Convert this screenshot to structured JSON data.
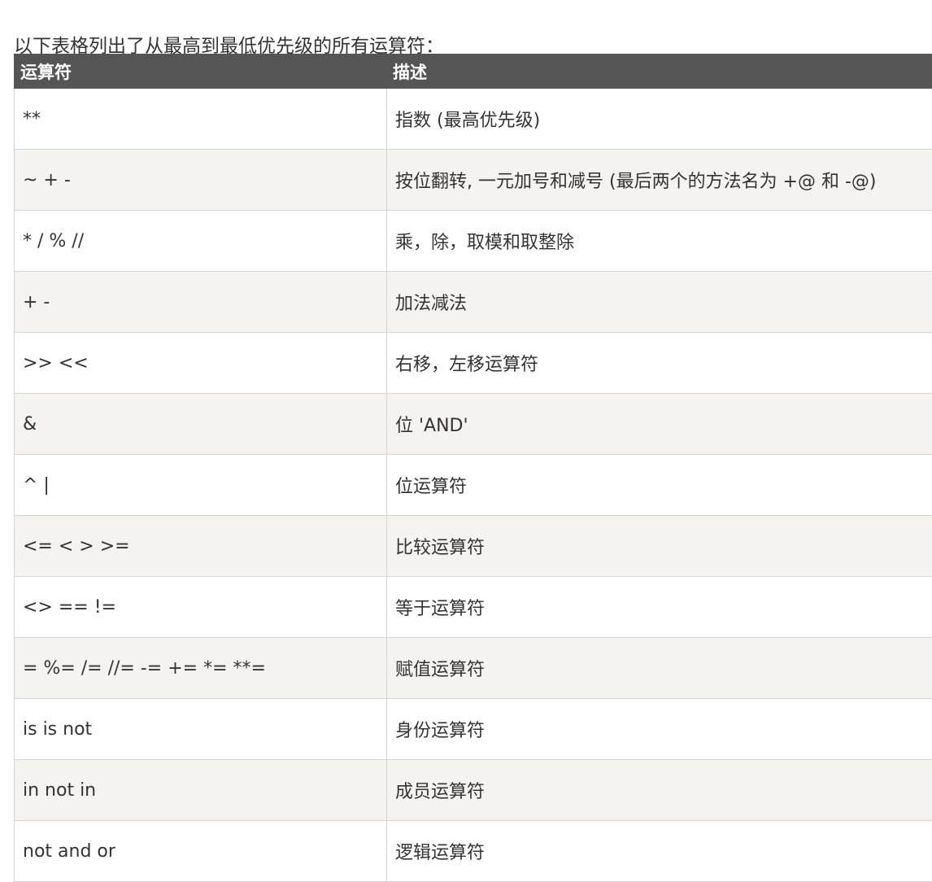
{
  "intro": "以下表格列出了从最高到最低优先级的所有运算符：",
  "table": {
    "headers": [
      "运算符",
      "描述"
    ],
    "rows": [
      [
        "**",
        "指数 (最高优先级)"
      ],
      [
        "~ + -",
        "按位翻转, 一元加号和减号 (最后两个的方法名为 +@ 和 -@)"
      ],
      [
        "* / % //",
        "乘，除，取模和取整除"
      ],
      [
        "+ -",
        "加法减法"
      ],
      [
        ">> <<",
        "右移，左移运算符"
      ],
      [
        "&",
        "位 'AND'"
      ],
      [
        "^ |",
        "位运算符"
      ],
      [
        "<= < > >=",
        "比较运算符"
      ],
      [
        "<> == !=",
        "等于运算符"
      ],
      [
        "= %= /= //= -= += *= **=",
        "赋值运算符"
      ],
      [
        "is is not",
        "身份运算符"
      ],
      [
        "in not in",
        "成员运算符"
      ],
      [
        "not and or",
        "逻辑运算符"
      ]
    ]
  },
  "colors": {
    "header_bg": "#555555",
    "header_text": "#ffffff",
    "row_alt_bg": "#f4f3f0",
    "border": "#d4d4d4",
    "text": "#333333"
  }
}
